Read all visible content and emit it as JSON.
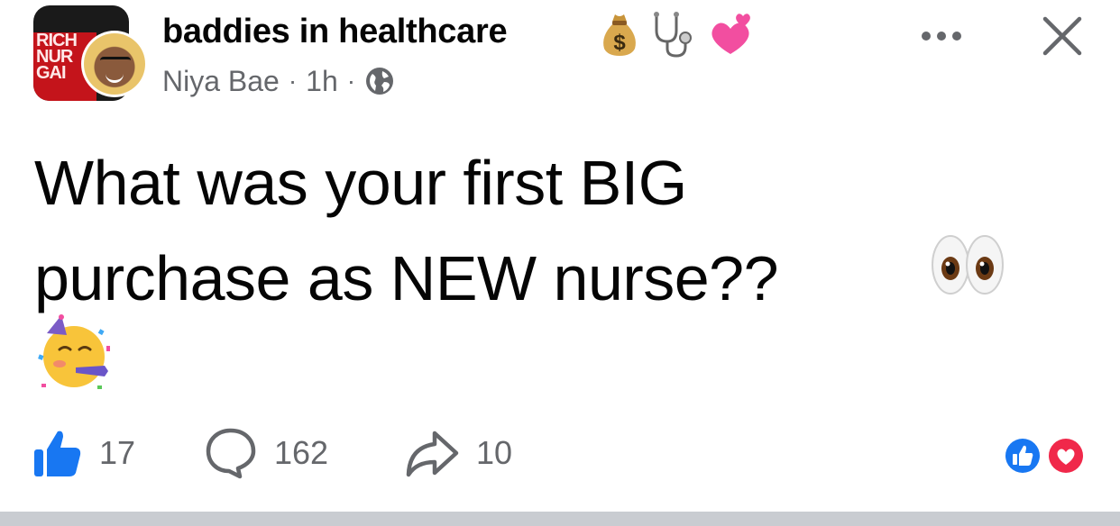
{
  "header": {
    "group_name": "baddies in healthcare",
    "author": "Niya Bae",
    "separator": "·",
    "time": "1h",
    "group_emojis": [
      "money-bag-emoji",
      "stethoscope-emoji",
      "two-hearts-emoji"
    ],
    "avatar_banner_text": [
      "RICH",
      "NUR",
      "GAI"
    ]
  },
  "post": {
    "line1": "What was your first BIG",
    "line2": "purchase as NEW nurse??",
    "trailing_emojis": [
      "eyes-emoji",
      "partying-face-emoji"
    ]
  },
  "footer": {
    "like_count": "17",
    "comment_count": "162",
    "share_count": "10",
    "reaction_types": [
      "like",
      "love"
    ]
  },
  "colors": {
    "like_blue": "#1877f2",
    "love_red": "#f0284a",
    "meta_gray": "#65676b",
    "text": "#050505"
  }
}
